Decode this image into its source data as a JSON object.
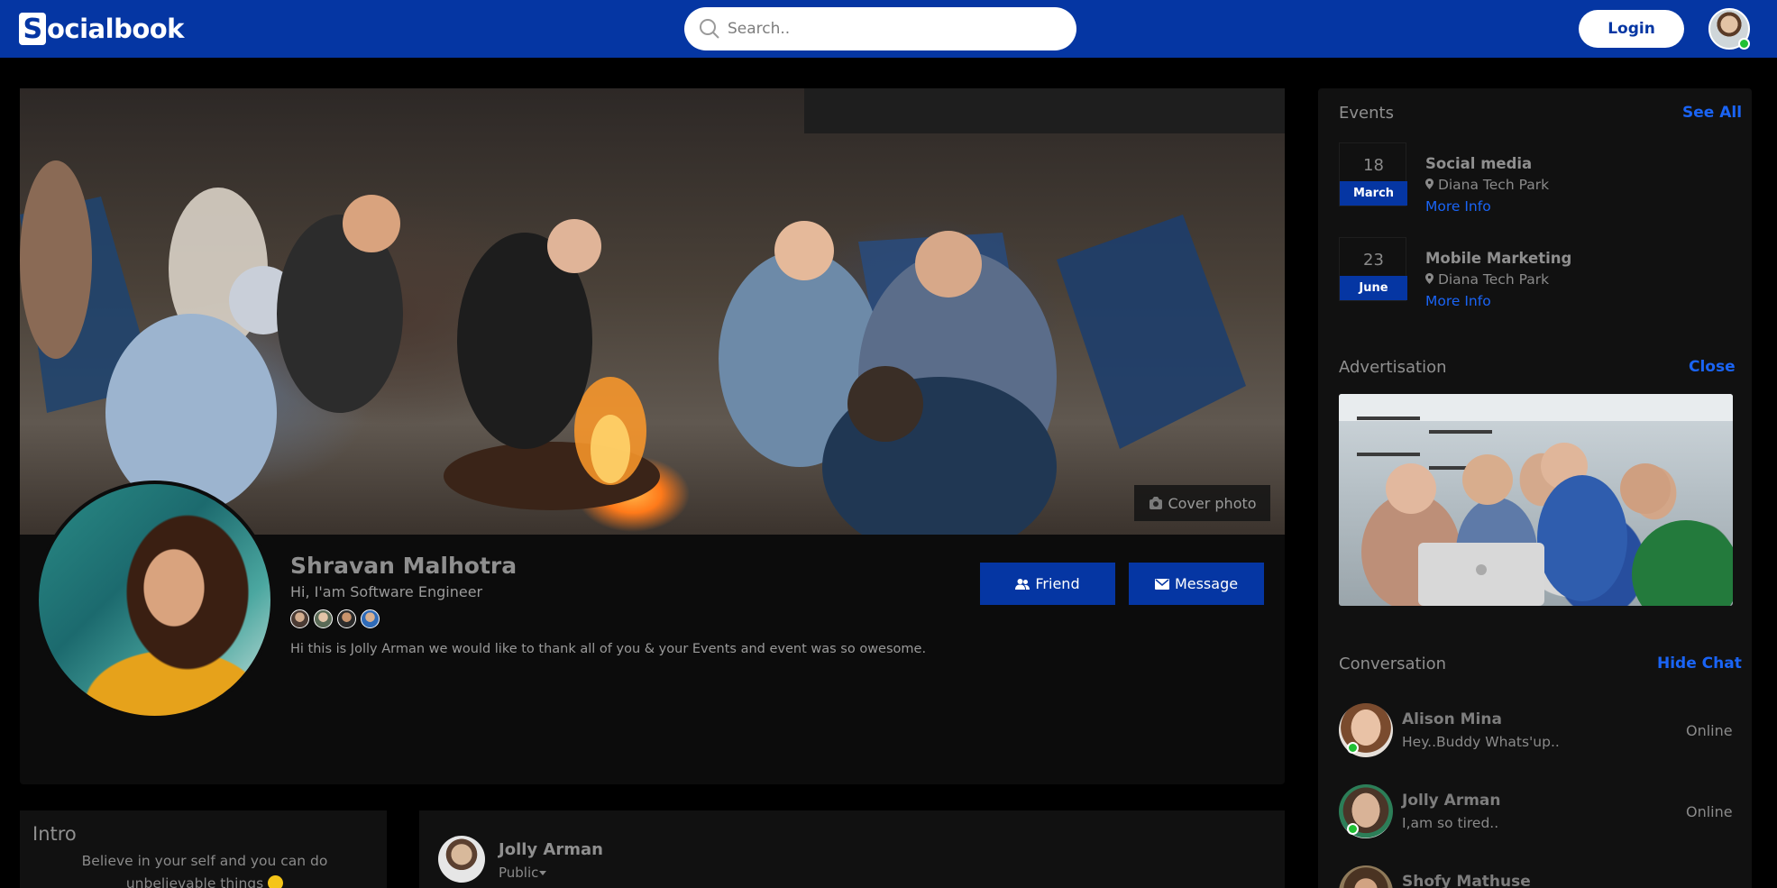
{
  "header": {
    "brand_mark": "S",
    "brand_rest": "ocialbook",
    "search_placeholder": "Search..",
    "login_label": "Login"
  },
  "profile": {
    "cover_button_label": "Cover photo",
    "name": "Shravan Malhotra",
    "tagline": "Hi, I'am Software Engineer",
    "bio": "Hi this is Jolly Arman we would like to thank all of you & your Events and event was so owesome.",
    "friend_button_label": "Friend",
    "message_button_label": "Message"
  },
  "intro": {
    "title": "Intro",
    "text": "Believe in your self and you can do unbelievable things"
  },
  "post": {
    "author": "Jolly Arman",
    "privacy": "Public"
  },
  "events": {
    "heading": "Events",
    "see_all_label": "See All",
    "items": [
      {
        "day": "18",
        "month": "March",
        "title": "Social media",
        "location": "Diana Tech Park",
        "more_label": "More Info"
      },
      {
        "day": "23",
        "month": "June",
        "title": "Mobile Marketing",
        "location": "Diana Tech Park",
        "more_label": "More Info"
      }
    ]
  },
  "advertisement": {
    "heading": "Advertisation",
    "close_label": "Close"
  },
  "conversation": {
    "heading": "Conversation",
    "hide_label": "Hide Chat",
    "items": [
      {
        "name": "Alison Mina",
        "message": "Hey..Buddy Whats'up..",
        "status": "Online"
      },
      {
        "name": "Jolly Arman",
        "message": "I,am so tired..",
        "status": "Online"
      },
      {
        "name": "Shofy Mathuse",
        "message": "",
        "status": ""
      }
    ]
  },
  "colors": {
    "brand_blue": "#0536a3",
    "link_blue": "#1a64f5",
    "online_green": "#21c034",
    "card_bg": "#0c0c0c"
  }
}
